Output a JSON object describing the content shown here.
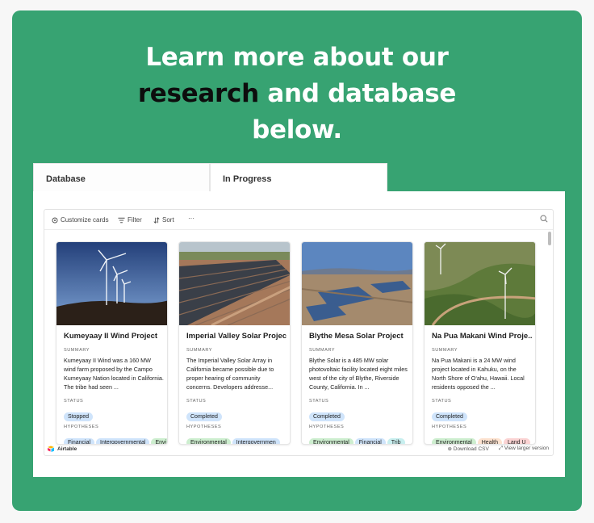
{
  "headline": {
    "line1": "Learn more about our",
    "line2_dark": "research",
    "line2_rest": " and database",
    "line3": "below."
  },
  "tabs": [
    {
      "label": "Database"
    },
    {
      "label": "In Progress"
    }
  ],
  "toolbar": {
    "customize_label": "Customize cards",
    "filter_label": "Filter",
    "sort_label": "Sort",
    "more_label": "···"
  },
  "labels": {
    "summary": "SUMMARY",
    "status": "STATUS",
    "hypotheses": "HYPOTHESES"
  },
  "cards": [
    {
      "title": "Kumeyaay II Wind Project",
      "summary": "Kumeyaay II Wind was a 160 MW wind farm proposed by the Campo Kumeyaay Nation located in California. The tribe had seen ...",
      "status": "Stopped",
      "hypotheses": [
        "Financial",
        "Intergovernmental",
        "Envi"
      ]
    },
    {
      "title": "Imperial Valley Solar Project",
      "summary": "The Imperial Valley Solar Array in California became possible due to proper hearing of community concerns. Developers addresse...",
      "status": "Completed",
      "hypotheses": [
        "Environmental",
        "Intergovernmen"
      ]
    },
    {
      "title": "Blythe Mesa Solar Project",
      "summary": "Blythe Solar is a 485 MW solar photovoltaic facility located eight miles west of the city of Blythe, Riverside County, California. In ...",
      "status": "Completed",
      "hypotheses": [
        "Environmental",
        "Financial",
        "Trib"
      ]
    },
    {
      "title": "Na Pua Makani Wind Proje...",
      "summary": "Na Pua Makani is a 24 MW wind project located in Kahuku, on the North Shore of O‘ahu, Hawaii. Local residents opposed the ...",
      "status": "Completed",
      "hypotheses": [
        "Environmental",
        "Health",
        "Land U"
      ]
    }
  ],
  "colors": {
    "panel": "#37a372",
    "status_stopped": "#cfe4fb",
    "status_completed": "#cfe4fb",
    "hyp_financial": "#cfe4fb",
    "hyp_intergovernmental": "#cfe4fb",
    "hyp_environmental": "#cdeecf",
    "hyp_health": "#fde2cf",
    "hyp_land": "#fbd3d3",
    "hyp_tribal": "#c8efef"
  },
  "footer": {
    "logo": "Airtable",
    "download": "Download CSV",
    "view_larger": "View larger version"
  }
}
